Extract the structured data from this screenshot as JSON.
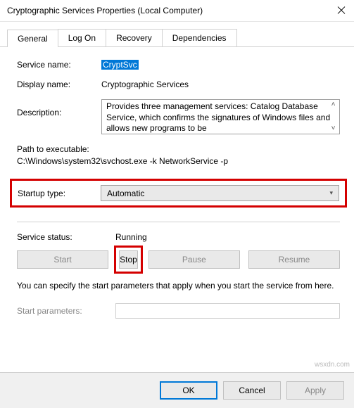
{
  "window": {
    "title": "Cryptographic Services Properties (Local Computer)"
  },
  "tabs": {
    "general": "General",
    "logon": "Log On",
    "recovery": "Recovery",
    "dependencies": "Dependencies"
  },
  "fields": {
    "service_name_label": "Service name:",
    "service_name_value": "CryptSvc",
    "display_name_label": "Display name:",
    "display_name_value": "Cryptographic Services",
    "description_label": "Description:",
    "description_value": "Provides three management services: Catalog Database Service, which confirms the signatures of Windows files and allows new programs to be",
    "path_label": "Path to executable:",
    "path_value": "C:\\Windows\\system32\\svchost.exe -k NetworkService -p",
    "startup_type_label": "Startup type:",
    "startup_type_value": "Automatic",
    "service_status_label": "Service status:",
    "service_status_value": "Running",
    "info_text": "You can specify the start parameters that apply when you start the service from here.",
    "start_params_label": "Start parameters:",
    "start_params_value": ""
  },
  "buttons": {
    "start": "Start",
    "stop": "Stop",
    "pause": "Pause",
    "resume": "Resume",
    "ok": "OK",
    "cancel": "Cancel",
    "apply": "Apply"
  },
  "watermark": "wsxdn.com"
}
